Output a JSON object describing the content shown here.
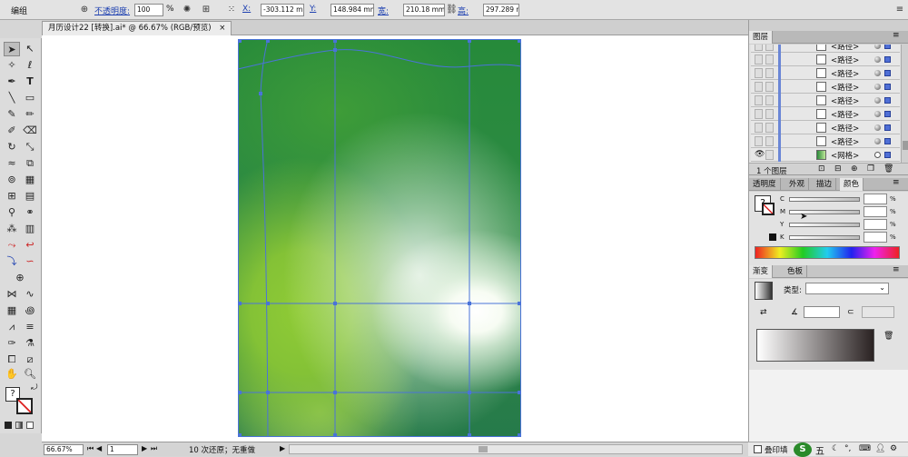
{
  "control_bar": {
    "mode": "编组",
    "opacity_label": "不透明度:",
    "opacity_value": "100",
    "opacity_unit": "%",
    "x_label": "X:",
    "x_value": "-303.112 mm",
    "y_label": "Y:",
    "y_value": "148.984 mm",
    "w_label": "宽:",
    "w_value": "210.18 mm",
    "h_label": "高:",
    "h_value": "297.289 mm"
  },
  "document_tab": {
    "title": "月历设计22 [转换].ai* @ 66.67% (RGB/预览)",
    "close": "×"
  },
  "layers": {
    "title": "图层",
    "rows": [
      {
        "name": "<路径>"
      },
      {
        "name": "<路径>"
      },
      {
        "name": "<路径>"
      },
      {
        "name": "<路径>"
      },
      {
        "name": "<路径>"
      },
      {
        "name": "<路径>"
      },
      {
        "name": "<路径>"
      },
      {
        "name": "<路径>"
      },
      {
        "name": "<网格>"
      }
    ],
    "count": "1 个图层"
  },
  "color_panel": {
    "tabs": [
      "透明度",
      "外观",
      "描边",
      "颜色"
    ],
    "channels": [
      "C",
      "M",
      "Y",
      "K"
    ],
    "pct": "%"
  },
  "gradient_panel": {
    "tabs": [
      "渐变",
      "色板"
    ],
    "type_label": "类型:"
  },
  "status_bar": {
    "zoom": "66.67%",
    "page": "1",
    "history": "10 次还原；无重做"
  },
  "taskbar": {
    "overprint_label": "叠印填",
    "ime": "五"
  },
  "colors": {
    "accent": "#1c3fb0",
    "mesh_line": "#4a73d9",
    "artboard_dark": "#267a4a",
    "artboard_light": "#8fcb35"
  }
}
